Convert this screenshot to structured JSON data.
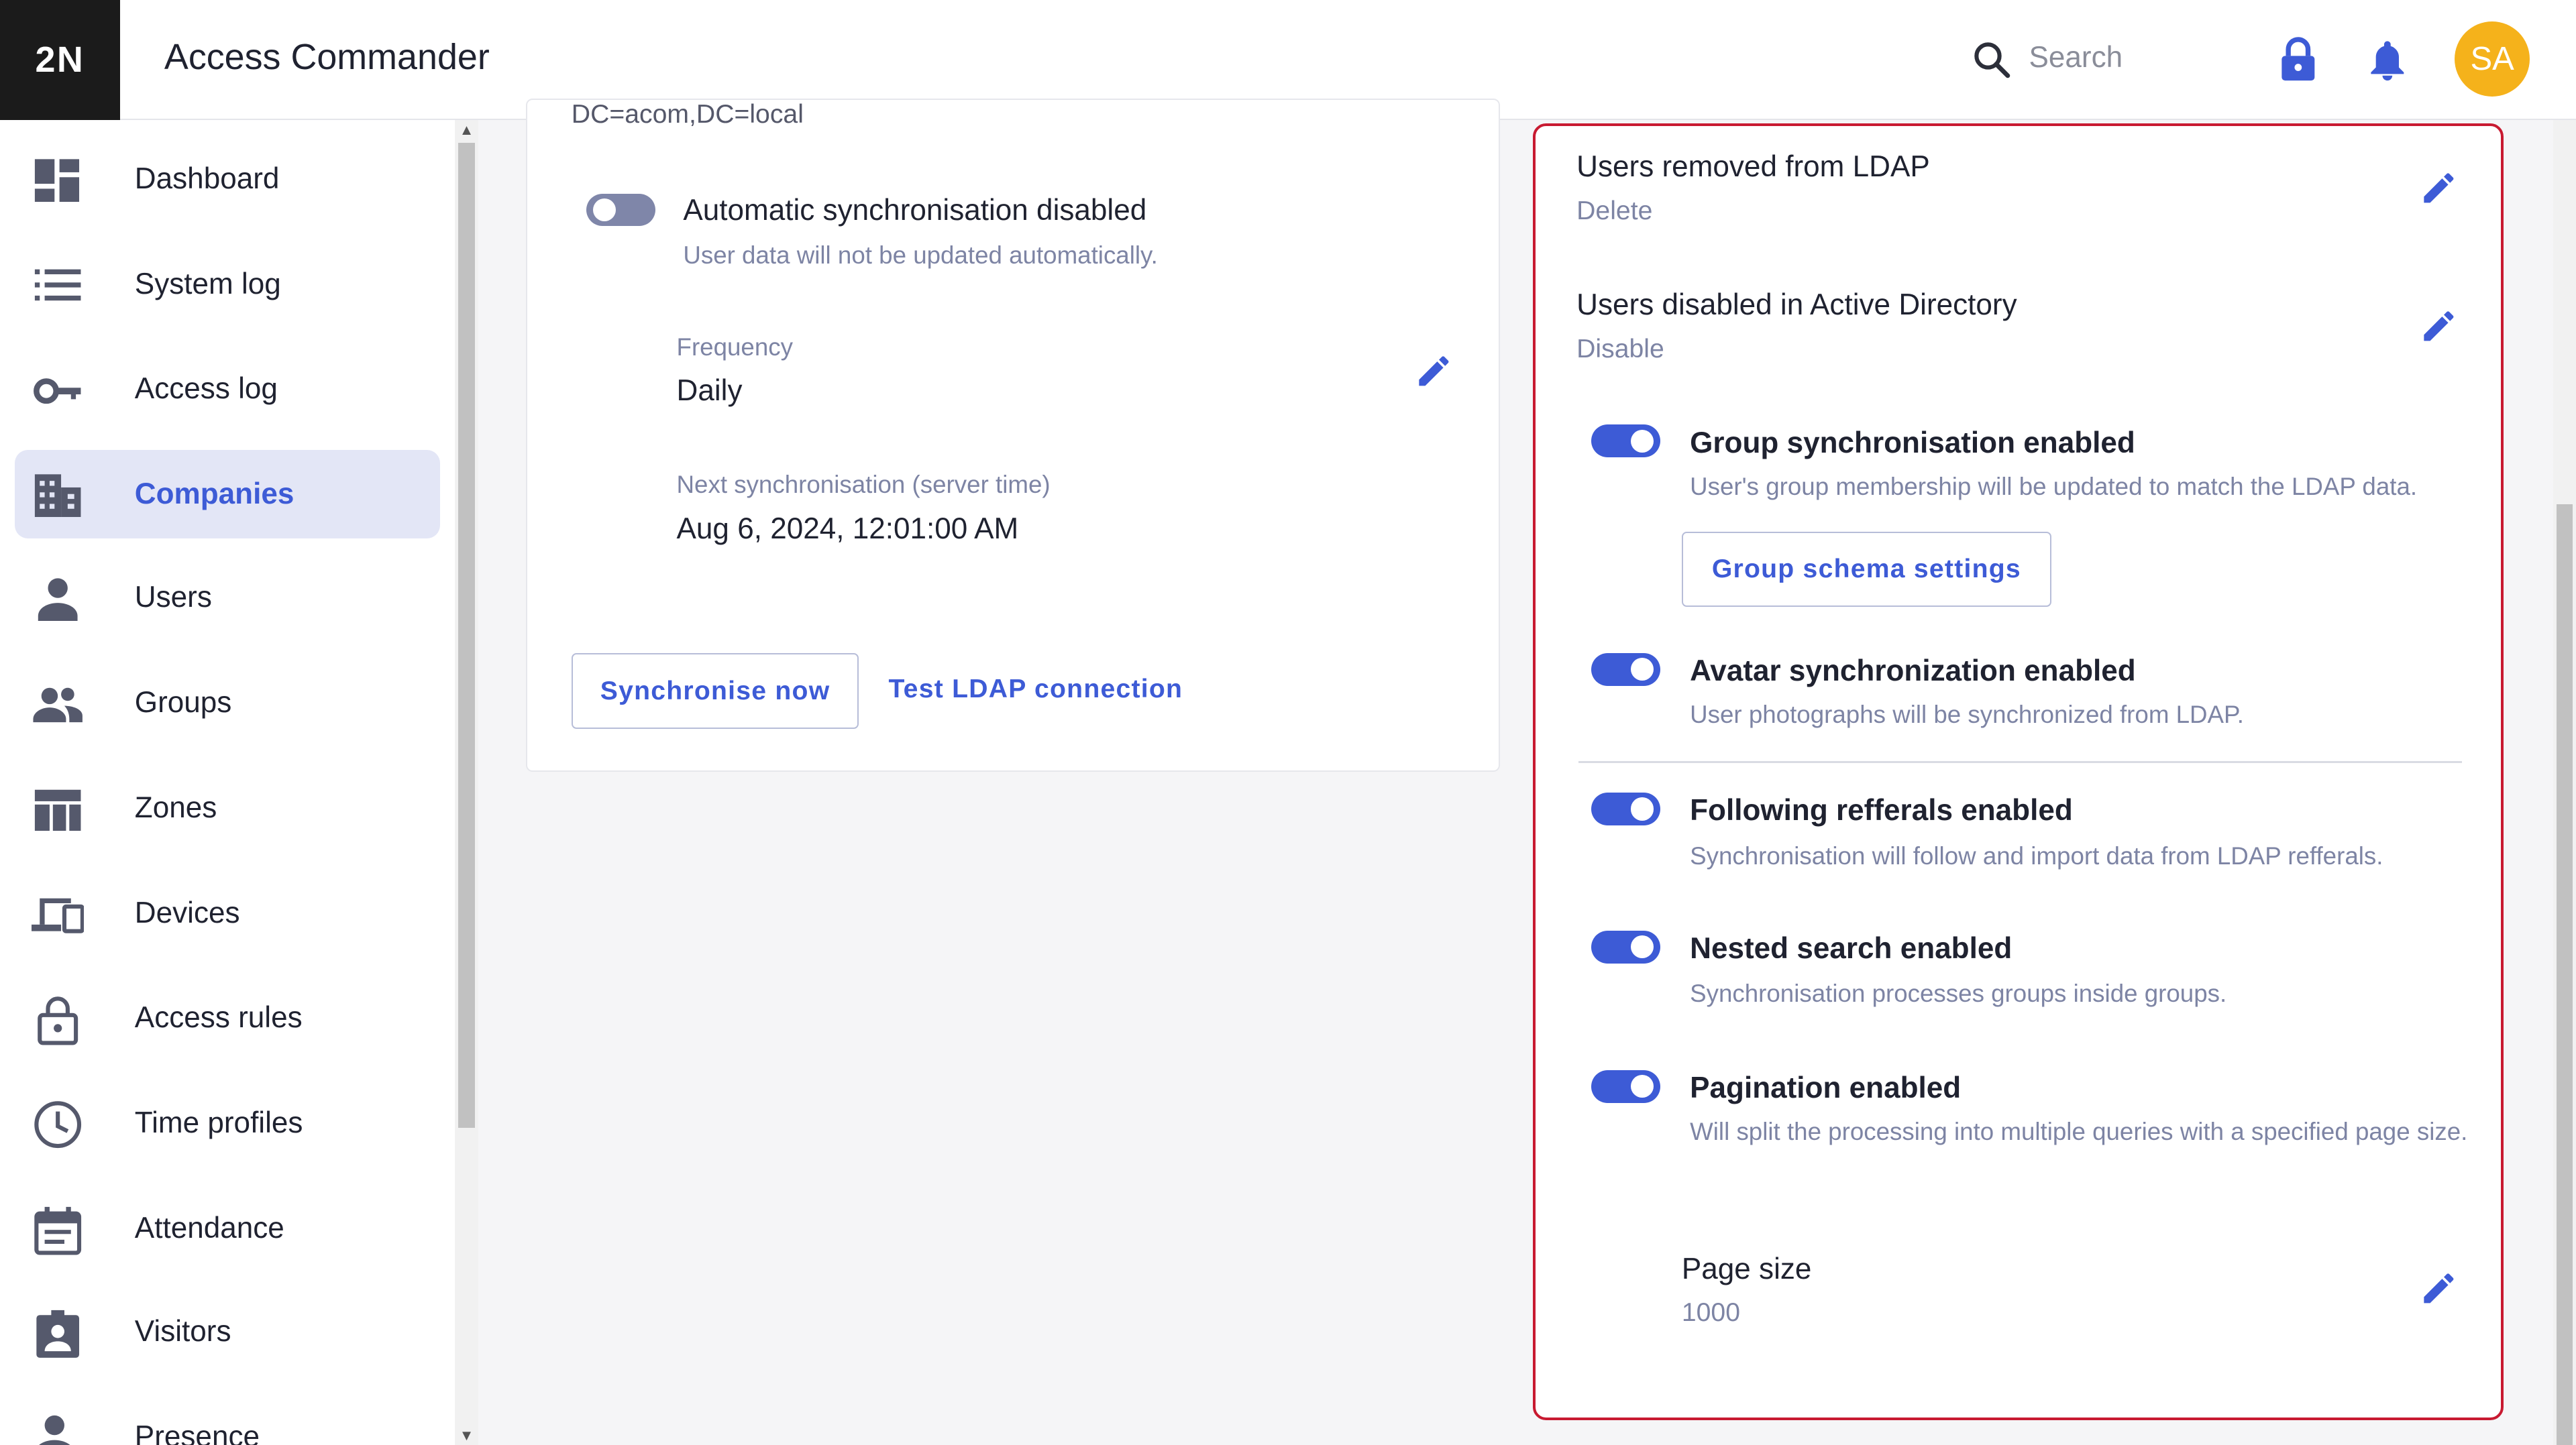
{
  "header": {
    "logo": "2N",
    "title": "Access Commander",
    "search_placeholder": "Search",
    "avatar_initials": "SA"
  },
  "sidebar": {
    "items": [
      {
        "label": "Dashboard",
        "icon": "dashboard-icon"
      },
      {
        "label": "System log",
        "icon": "list-icon"
      },
      {
        "label": "Access log",
        "icon": "key-icon"
      },
      {
        "label": "Companies",
        "icon": "building-icon",
        "active": true
      },
      {
        "label": "Users",
        "icon": "user-icon"
      },
      {
        "label": "Groups",
        "icon": "group-icon"
      },
      {
        "label": "Zones",
        "icon": "zones-icon"
      },
      {
        "label": "Devices",
        "icon": "devices-icon"
      },
      {
        "label": "Access rules",
        "icon": "lock-rule-icon"
      },
      {
        "label": "Time profiles",
        "icon": "clock-icon"
      },
      {
        "label": "Attendance",
        "icon": "calendar-icon"
      },
      {
        "label": "Visitors",
        "icon": "badge-icon"
      },
      {
        "label": "Presence",
        "icon": "presence-icon"
      }
    ]
  },
  "left_card": {
    "cut_text": "DC=acom,DC=local",
    "auto_sync": {
      "title": "Automatic synchronisation disabled",
      "desc": "User data will not be updated automatically.",
      "enabled": false
    },
    "frequency": {
      "label": "Frequency",
      "value": "Daily"
    },
    "next_sync": {
      "label": "Next synchronisation (server time)",
      "value": "Aug 6, 2024, 12:01:00 AM"
    },
    "sync_button": "Synchronise now",
    "test_button": "Test LDAP connection"
  },
  "right_card": {
    "removed": {
      "title": "Users removed from LDAP",
      "value": "Delete"
    },
    "disabled": {
      "title": "Users disabled in Active Directory",
      "value": "Disable"
    },
    "group_sync": {
      "title": "Group synchronisation enabled",
      "desc": "User's group membership will be updated to match the LDAP data.",
      "enabled": true
    },
    "group_schema_button": "Group schema settings",
    "avatar_sync": {
      "title": "Avatar synchronization enabled",
      "desc": "User photographs will be synchronized from LDAP.",
      "enabled": true
    },
    "referrals": {
      "title": "Following refferals enabled",
      "desc": "Synchronisation will follow and import data from LDAP refferals.",
      "enabled": true
    },
    "nested": {
      "title": "Nested search enabled",
      "desc": "Synchronisation processes groups inside groups.",
      "enabled": true
    },
    "pagination": {
      "title": "Pagination enabled",
      "desc": "Will split the processing into multiple queries with a specified page size.",
      "enabled": true
    },
    "page_size": {
      "label": "Page size",
      "value": "1000"
    }
  },
  "colors": {
    "accent": "#3d5bd6",
    "highlight_border": "#c81a31",
    "avatar": "#f5b21b",
    "active_nav": "#e3e6f6"
  }
}
